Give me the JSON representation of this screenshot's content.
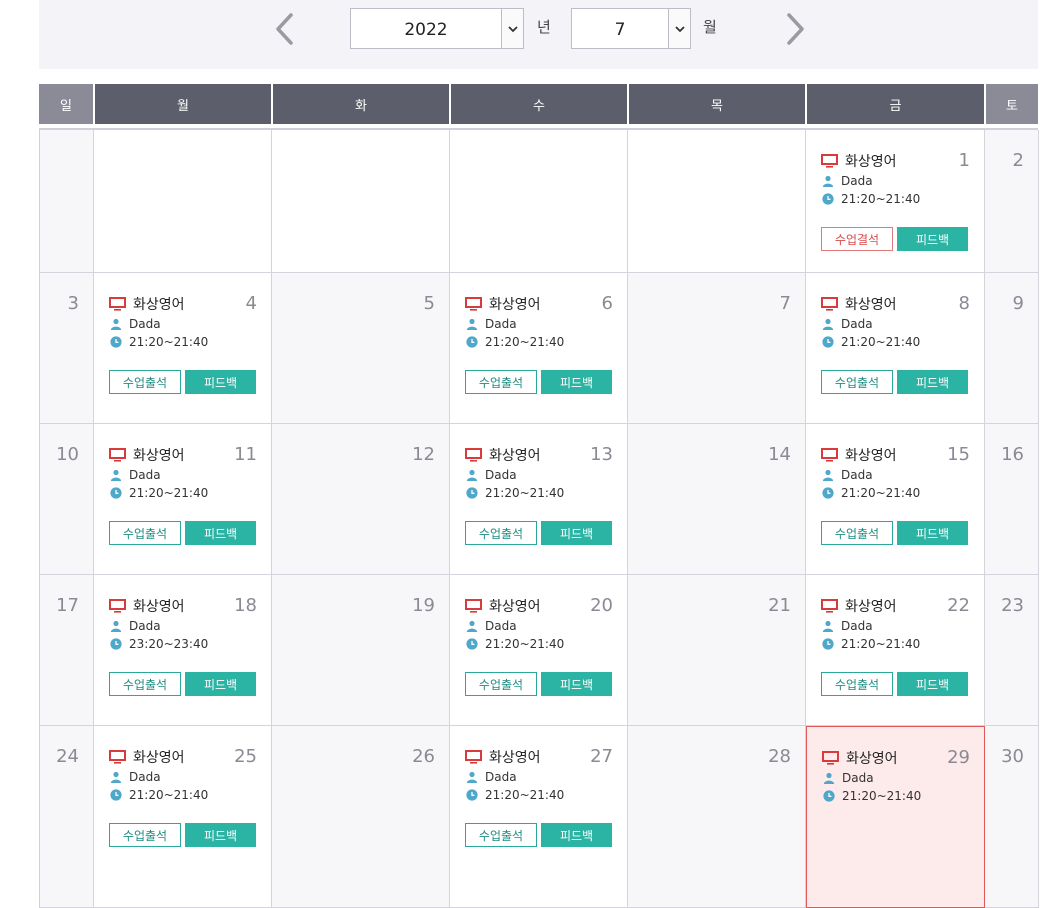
{
  "nav": {
    "year": "2022",
    "year_suffix": "년",
    "month": "7",
    "month_suffix": "월"
  },
  "weekdays": [
    "일",
    "월",
    "화",
    "수",
    "목",
    "금",
    "토"
  ],
  "lesson_title": "화상영어",
  "teacher": "Dada",
  "labels": {
    "attend": "수업출석",
    "absent": "수업결석",
    "feedback": "피드백"
  },
  "colors": {
    "header_weekday": "#5d5e6b",
    "header_weekend": "#8a8b96",
    "accent_teal": "#2bb3a3",
    "accent_red": "#d84a4a",
    "today_bg": "#fdebeb"
  },
  "weeks": [
    {
      "days": [
        {
          "num": ""
        },
        {
          "num": ""
        },
        {
          "num": ""
        },
        {
          "num": ""
        },
        {
          "num": ""
        },
        {
          "num": "1",
          "lesson": true,
          "time": "21:20~21:40",
          "status": "absent",
          "feedback": true
        },
        {
          "num": "2"
        }
      ]
    },
    {
      "days": [
        {
          "num": "3"
        },
        {
          "num": "4",
          "lesson": true,
          "time": "21:20~21:40",
          "status": "attend",
          "feedback": true
        },
        {
          "num": "5"
        },
        {
          "num": "6",
          "lesson": true,
          "time": "21:20~21:40",
          "status": "attend",
          "feedback": true
        },
        {
          "num": "7"
        },
        {
          "num": "8",
          "lesson": true,
          "time": "21:20~21:40",
          "status": "attend",
          "feedback": true
        },
        {
          "num": "9"
        }
      ]
    },
    {
      "days": [
        {
          "num": "10"
        },
        {
          "num": "11",
          "lesson": true,
          "time": "21:20~21:40",
          "status": "attend",
          "feedback": true
        },
        {
          "num": "12"
        },
        {
          "num": "13",
          "lesson": true,
          "time": "21:20~21:40",
          "status": "attend",
          "feedback": true
        },
        {
          "num": "14"
        },
        {
          "num": "15",
          "lesson": true,
          "time": "21:20~21:40",
          "status": "attend",
          "feedback": true
        },
        {
          "num": "16"
        }
      ]
    },
    {
      "days": [
        {
          "num": "17"
        },
        {
          "num": "18",
          "lesson": true,
          "time": "23:20~23:40",
          "status": "attend",
          "feedback": true
        },
        {
          "num": "19"
        },
        {
          "num": "20",
          "lesson": true,
          "time": "21:20~21:40",
          "status": "attend",
          "feedback": true
        },
        {
          "num": "21"
        },
        {
          "num": "22",
          "lesson": true,
          "time": "21:20~21:40",
          "status": "attend",
          "feedback": true
        },
        {
          "num": "23"
        }
      ]
    },
    {
      "days": [
        {
          "num": "24"
        },
        {
          "num": "25",
          "lesson": true,
          "time": "21:20~21:40",
          "status": "attend",
          "feedback": true
        },
        {
          "num": "26"
        },
        {
          "num": "27",
          "lesson": true,
          "time": "21:20~21:40",
          "status": "attend",
          "feedback": true
        },
        {
          "num": "28"
        },
        {
          "num": "29",
          "lesson": true,
          "time": "21:20~21:40",
          "status": "",
          "feedback": false,
          "today": true
        },
        {
          "num": "30"
        }
      ]
    }
  ]
}
